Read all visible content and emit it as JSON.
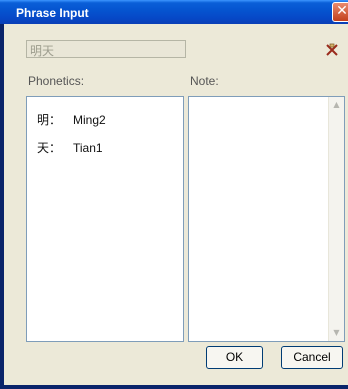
{
  "window": {
    "title": "Phrase Input",
    "close_glyph": "✕"
  },
  "phrase": {
    "value": "明天"
  },
  "clear_icon": "clear-icon",
  "labels": {
    "phonetics": "Phonetics:",
    "note": "Note:"
  },
  "phonetics": [
    {
      "char": "明：",
      "pinyin": "Ming2"
    },
    {
      "char": "天：",
      "pinyin": "Tian1"
    }
  ],
  "note": {
    "value": ""
  },
  "buttons": {
    "ok": "OK",
    "cancel": "Cancel"
  }
}
